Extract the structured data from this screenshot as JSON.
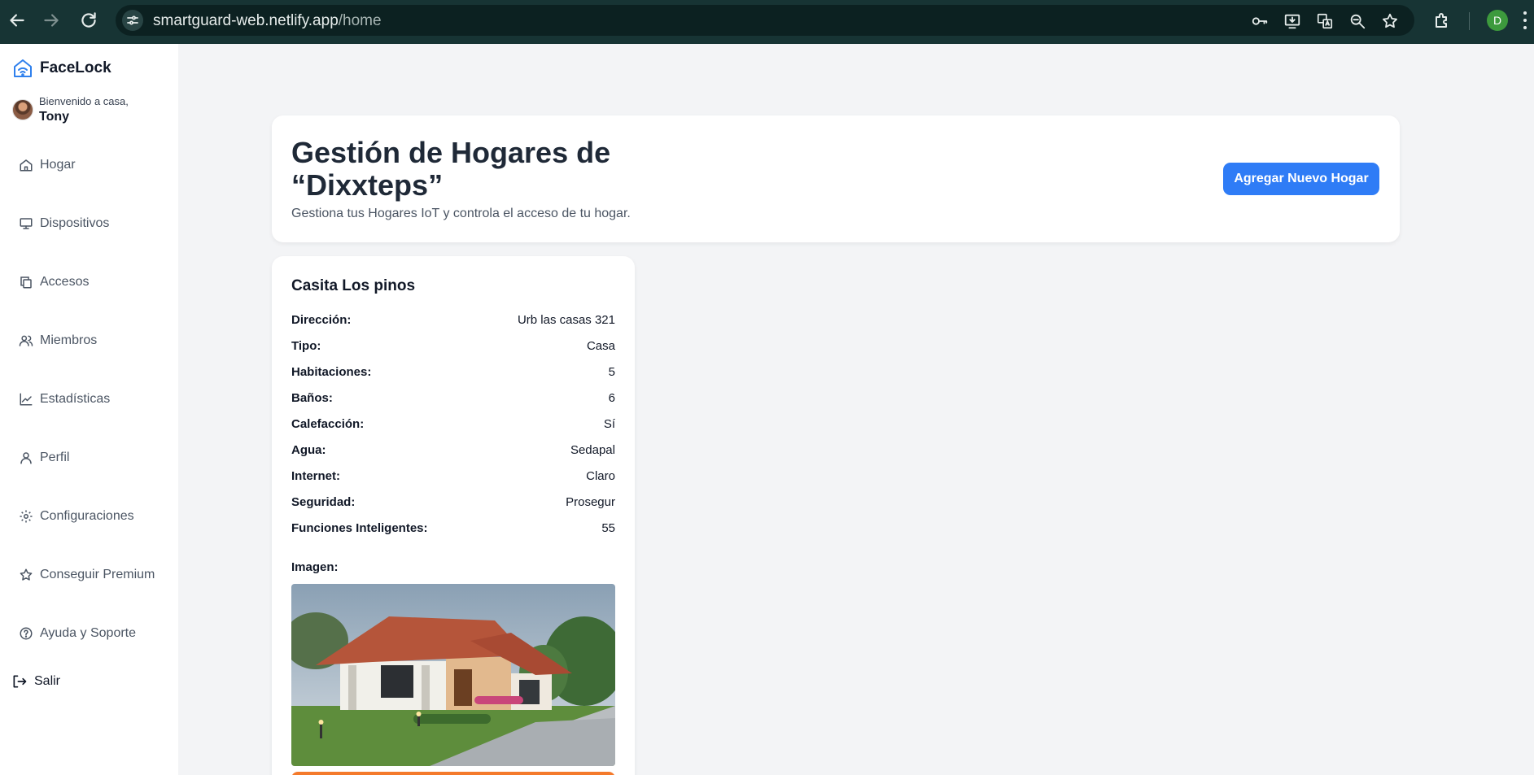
{
  "browser": {
    "url_host": "smartguard-web.netlify.app",
    "url_path": "/home",
    "profile_initial": "D"
  },
  "sidebar": {
    "app_name": "FaceLock",
    "welcome": "Bienvenido a casa,",
    "user_name": "Tony",
    "items": [
      {
        "label": "Hogar",
        "icon": "home-icon"
      },
      {
        "label": "Dispositivos",
        "icon": "monitor-icon"
      },
      {
        "label": "Accesos",
        "icon": "copy-icon"
      },
      {
        "label": "Miembros",
        "icon": "users-icon"
      },
      {
        "label": "Estadísticas",
        "icon": "chart-line-icon"
      },
      {
        "label": "Perfil",
        "icon": "user-icon"
      },
      {
        "label": "Configuraciones",
        "icon": "gear-icon"
      },
      {
        "label": "Conseguir Premium",
        "icon": "star-icon"
      },
      {
        "label": "Ayuda y Soporte",
        "icon": "help-circle-icon"
      }
    ],
    "logout_label": "Salir"
  },
  "header": {
    "title": "Gestión de Hogares de “Dixxteps”",
    "subtitle": "Gestiona tus Hogares IoT y controla el acceso de tu hogar.",
    "add_button": "Agregar Nuevo Hogar"
  },
  "home_card": {
    "name": "Casita Los pinos",
    "fields": [
      {
        "label": "Dirección:",
        "value": "Urb las casas 321"
      },
      {
        "label": "Tipo:",
        "value": "Casa"
      },
      {
        "label": "Habitaciones:",
        "value": "5"
      },
      {
        "label": "Baños:",
        "value": "6"
      },
      {
        "label": "Calefacción:",
        "value": "Sí"
      },
      {
        "label": "Agua:",
        "value": "Sedapal"
      },
      {
        "label": "Internet:",
        "value": "Claro"
      },
      {
        "label": "Seguridad:",
        "value": "Prosegur"
      },
      {
        "label": "Funciones Inteligentes:",
        "value": "55"
      }
    ],
    "image_label": "Imagen:"
  },
  "colors": {
    "accent": "#2f7cf6",
    "chrome": "#173434",
    "orange": "#f47a2b"
  }
}
